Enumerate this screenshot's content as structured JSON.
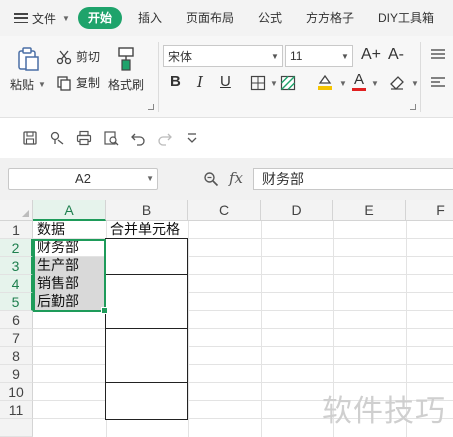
{
  "menu": {
    "file_label": "文件",
    "tabs": [
      "开始",
      "插入",
      "页面布局",
      "公式",
      "方方格子",
      "DIY工具箱"
    ],
    "active_tab": "开始"
  },
  "ribbon": {
    "paste_label": "粘贴",
    "cut_label": "剪切",
    "copy_label": "复制",
    "format_painter_label": "格式刷",
    "font_name": "宋体",
    "font_size": "11",
    "grow_font": "A+",
    "shrink_font": "A-",
    "bold": "B",
    "italic": "I",
    "underline": "U",
    "accent_color": "#1ea36b",
    "highlight_color": "#f5c400",
    "font_color": "#e02020"
  },
  "formula_bar": {
    "name_box": "A2",
    "fx_label": "fx",
    "formula_value": "财务部"
  },
  "sheet": {
    "columns": [
      "A",
      "B",
      "C",
      "D",
      "E",
      "F"
    ],
    "rows": [
      "1",
      "2",
      "3",
      "4",
      "5",
      "6",
      "7",
      "8",
      "9",
      "10",
      "11"
    ],
    "a1": "数据",
    "b1": "合并单元格",
    "a2": "财务部",
    "a3": "生产部",
    "a4": "销售部",
    "a5": "后勤部"
  },
  "watermark": "软件技巧"
}
